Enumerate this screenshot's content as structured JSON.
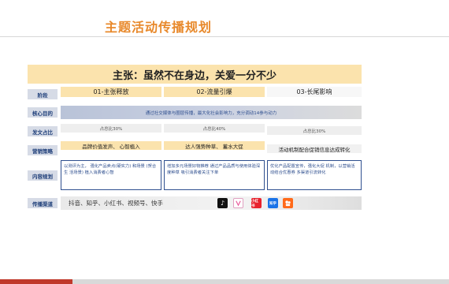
{
  "title": "主题活动传播规划",
  "banner": "主张：虽然不在身边，关爱一分不少",
  "labels": {
    "stage": "阶段",
    "core": "核心目的",
    "share": "发文占比",
    "strategy": "营销策略",
    "content": "内容规划",
    "channel": "传播渠道"
  },
  "stages": [
    "01-主张释放",
    "02-流量引爆",
    "03-长尾影响"
  ],
  "core_goal": "通过社交媒体与圈层传播，最大化社会影响力，充分调动14参与动力",
  "shares": [
    "占总比30%",
    "占总比40%",
    "占总比30%"
  ],
  "strategies": [
    "品牌价值发声、  心智植入",
    "达人强势种草、  蓄水大促",
    "活动机制配合促销信息达成转化"
  ],
  "contents": [
    "以测评为主， 强化产品卖点(硬实力) 和场景 (贺合生 活场景) 植入消费者心智",
    "增加多元场景好物推荐 通过产品品质与使用体验深度种草 吸引消费者关注下单",
    "优化产品配置宣传，强化大促 机制，以营销活动结合优惠券 多渠道引流转化"
  ],
  "channels": "抖音、知乎、小红书、视频号、快手",
  "channel_icons": [
    {
      "name": "douyin-icon",
      "label": "♪",
      "color": "#111111"
    },
    {
      "name": "xiaohongshu-icon",
      "label": "",
      "color": "#ffffff"
    },
    {
      "name": "weibo-red-icon",
      "label": "小红书",
      "color": "#e8222d"
    },
    {
      "name": "zhihu-icon",
      "label": "知乎",
      "color": "#1a73e8"
    },
    {
      "name": "kuaishou-icon",
      "label": "",
      "color": "#ff6a1a"
    }
  ],
  "colors": {
    "accent": "#e8892b",
    "navy": "#2f4f8f",
    "yellow": "#fbe3ad"
  }
}
